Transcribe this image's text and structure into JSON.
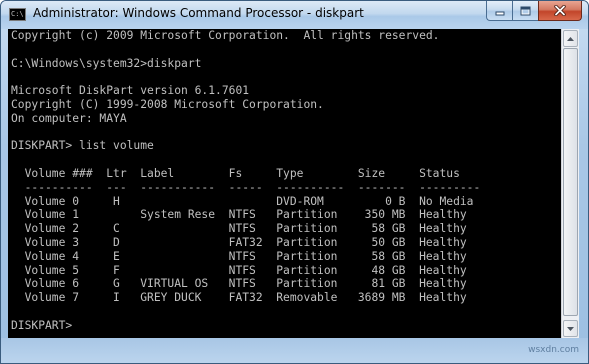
{
  "window": {
    "title": "Administrator: Windows Command Processor - diskpart",
    "icon_label": "C:\\",
    "buttons": {
      "minimize": "minimize-icon",
      "maximize": "maximize-icon",
      "close": "close-icon"
    }
  },
  "console": {
    "lines": [
      "Copyright (c) 2009 Microsoft Corporation.  All rights reserved.",
      "",
      "C:\\Windows\\system32>diskpart",
      "",
      "Microsoft DiskPart version 6.1.7601",
      "Copyright (C) 1999-2008 Microsoft Corporation.",
      "On computer: MAYA",
      "",
      "DISKPART> list volume",
      "",
      "  Volume ###  Ltr  Label        Fs     Type        Size     Status",
      "  ----------  ---  -----------  -----  ----------  -------  ---------",
      "  Volume 0     H                       DVD-ROM         0 B  No Media",
      "  Volume 1         System Rese  NTFS   Partition    350 MB  Healthy",
      "  Volume 2     C                NTFS   Partition     58 GB  Healthy",
      "  Volume 3     D                FAT32  Partition     50 GB  Healthy",
      "  Volume 4     E                NTFS   Partition     58 GB  Healthy",
      "  Volume 5     F                NTFS   Partition     48 GB  Healthy",
      "  Volume 6     G   VIRTUAL OS   NTFS   Partition     81 GB  Healthy",
      "  Volume 7     I   GREY DUCK    FAT32  Removable   3689 MB  Healthy",
      "",
      "DISKPART> "
    ]
  },
  "watermark": "wsxdn.com",
  "colors": {
    "console_bg": "#000000",
    "console_fg": "#c0c0c0",
    "frame": "#a9c7e6",
    "close_button": "#c2452a"
  }
}
